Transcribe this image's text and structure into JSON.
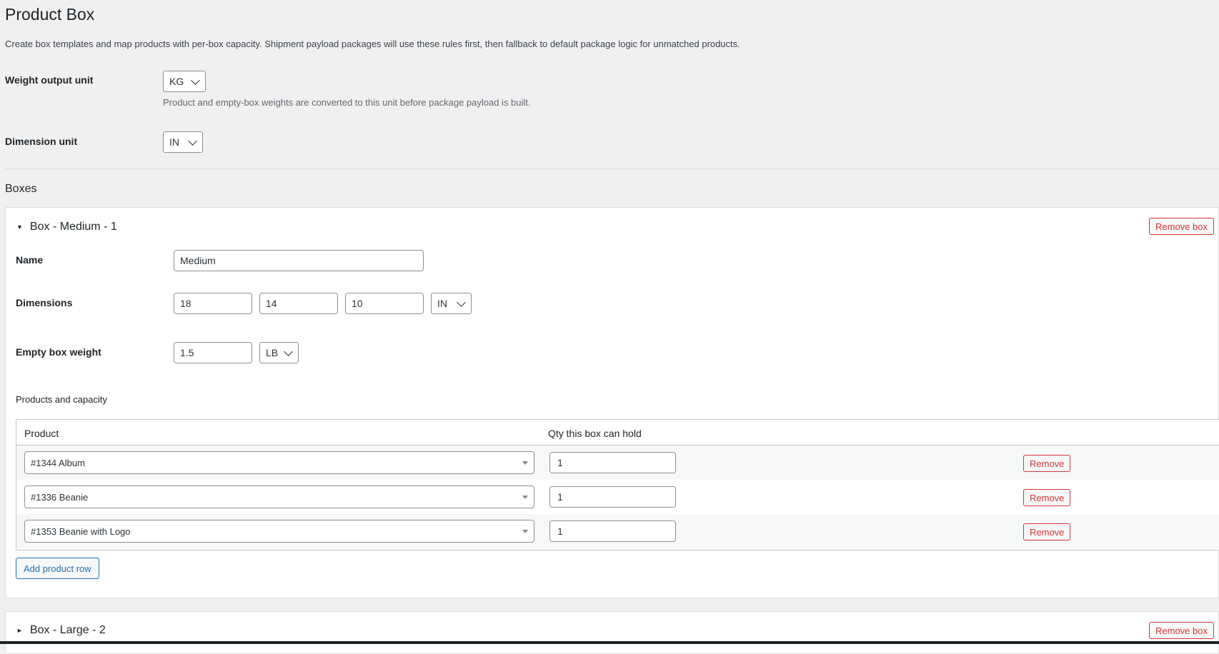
{
  "page": {
    "title": "Product Box",
    "description": "Create box templates and map products with per-box capacity. Shipment payload packages will use these rules first, then fallback to default package logic for unmatched products."
  },
  "settings": {
    "weight_label": "Weight output unit",
    "weight_value": "KG",
    "weight_help": "Product and empty-box weights are converted to this unit before package payload is built.",
    "dimension_label": "Dimension unit",
    "dimension_value": "IN"
  },
  "boxes_section": {
    "title": "Boxes"
  },
  "box1": {
    "title": "Box - Medium - 1",
    "expanded": true,
    "remove_label": "Remove box",
    "name_label": "Name",
    "name_value": "Medium",
    "dimensions_label": "Dimensions",
    "dim_length": "18",
    "dim_width": "14",
    "dim_height": "10",
    "dim_unit": "IN",
    "weight_label": "Empty box weight",
    "weight_value": "1.5",
    "weight_unit": "LB",
    "products_label": "Products and capacity",
    "col_product": "Product",
    "col_qty": "Qty this box can hold",
    "rows": [
      {
        "product": "#1344 Album",
        "qty": "1",
        "remove": "Remove"
      },
      {
        "product": "#1336 Beanie",
        "qty": "1",
        "remove": "Remove"
      },
      {
        "product": "#1353 Beanie with Logo",
        "qty": "1",
        "remove": "Remove"
      }
    ],
    "add_row_label": "Add product row"
  },
  "box2": {
    "title": "Box - Large - 2",
    "expanded": false,
    "remove_label": "Remove box"
  },
  "icons": {
    "expanded": "triangle-down-icon",
    "collapsed": "triangle-right-icon",
    "select": "chevron-down-icon"
  },
  "colors": {
    "background": "#f0f0f1",
    "danger": "#d63638",
    "primary": "#2271b1"
  }
}
